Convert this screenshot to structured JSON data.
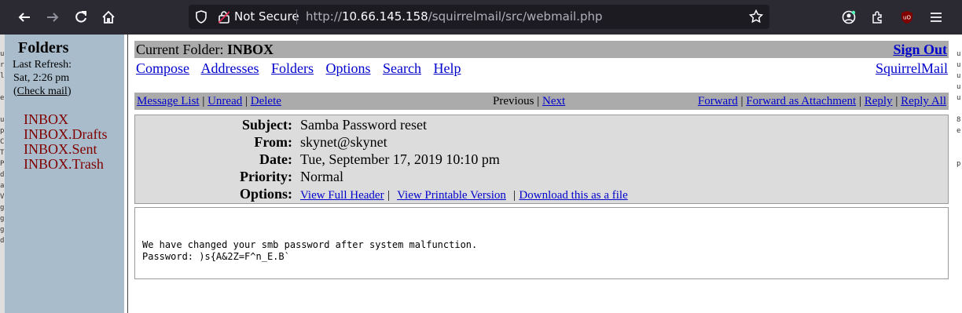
{
  "browser": {
    "not_secure_label": "Not Secure",
    "url_prefix": "http://",
    "url_host": "10.66.145.158",
    "url_path": "/squirrelmail/src/webmail.php"
  },
  "left": {
    "folders_title": "Folders",
    "last_refresh_label": "Last Refresh:",
    "refresh_time": "Sat, 2:26 pm",
    "check_mail_open": "(",
    "check_mail_label": "Check mail",
    "check_mail_close": ")",
    "folders": [
      "INBOX",
      "INBOX.Drafts",
      "INBOX.Sent",
      "INBOX.Trash"
    ]
  },
  "top": {
    "current_folder_label": "Current Folder:",
    "current_folder": "INBOX",
    "sign_out": "Sign Out",
    "nav": [
      "Compose",
      "Addresses",
      "Folders",
      "Options",
      "Search",
      "Help"
    ],
    "brand_link": "SquirrelMail"
  },
  "msgbar": {
    "message_list": "Message List",
    "unread": "Unread",
    "delete": "Delete",
    "previous": "Previous",
    "next": "Next",
    "forward": "Forward",
    "forward_attachment": "Forward as Attachment",
    "reply": "Reply",
    "reply_all": "Reply All",
    "sep": "|"
  },
  "headers": {
    "subject_label": "Subject:",
    "subject": "Samba Password reset",
    "from_label": "From:",
    "from": "skynet@skynet",
    "date_label": "Date:",
    "date": "Tue, September 17, 2019 10:10 pm",
    "priority_label": "Priority:",
    "priority": "Normal",
    "options_label": "Options:",
    "view_full_header": "View Full Header",
    "view_printable": "View Printable Version",
    "download_file": "Download this as a file"
  },
  "body": {
    "line1": "We have changed your smb password after system malfunction.",
    "line2": "Password: )s{A&2Z=F^n_E.B`"
  },
  "edge_text": {
    "left": "u\nr\nl\n\ne\n\nu\np\nC\nT\nP\nd\na\nV\ng\ng\ng\nd",
    "right": "u\nu\nu\nu\nu\n\n8\ne\n\n\np"
  }
}
